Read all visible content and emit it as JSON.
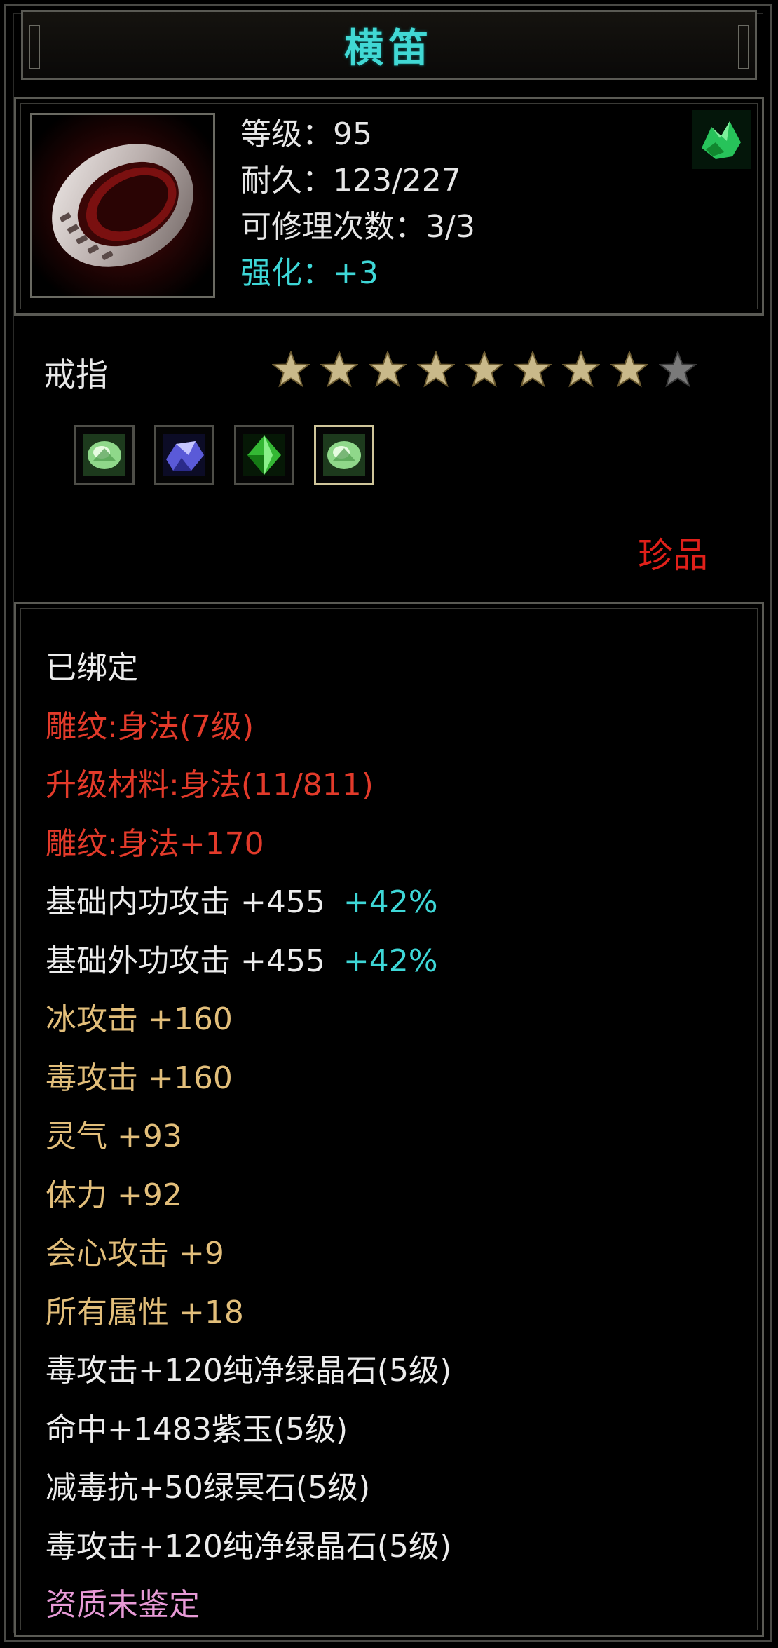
{
  "item": {
    "name": "横笛",
    "icon": "ring-icon",
    "badge_icon": "green-crystal-icon",
    "level_line": "等级：95",
    "durability_line": "耐久：123/227",
    "repairs_line": "可修理次数：3/3",
    "enhance_line": "强化：+3",
    "type": "戒指",
    "stars_filled": 8,
    "stars_total": 9,
    "gem_slots": [
      {
        "icon": "pale-green-gem-icon",
        "selected": false
      },
      {
        "icon": "purple-gem-icon",
        "selected": false
      },
      {
        "icon": "green-gem-icon",
        "selected": false
      },
      {
        "icon": "pale-green-gem-icon",
        "selected": true
      }
    ],
    "rarity": "珍品"
  },
  "attributes": [
    {
      "text": "已绑定",
      "color": "white"
    },
    {
      "text": "雕纹:身法(7级)",
      "color": "red"
    },
    {
      "text": "升级材料:身法(11/811)",
      "color": "red"
    },
    {
      "text": "雕纹:身法+170",
      "color": "red"
    },
    {
      "text": "基础内功攻击  +455",
      "color": "white",
      "bonus": "+42%"
    },
    {
      "text": "基础外功攻击  +455",
      "color": "white",
      "bonus": "+42%"
    },
    {
      "text": "冰攻击  +160",
      "color": "gold"
    },
    {
      "text": "毒攻击  +160",
      "color": "gold"
    },
    {
      "text": "灵气  +93",
      "color": "gold"
    },
    {
      "text": "体力  +92",
      "color": "gold"
    },
    {
      "text": "会心攻击  +9",
      "color": "gold"
    },
    {
      "text": "所有属性  +18",
      "color": "gold"
    },
    {
      "text": "毒攻击+120纯净绿晶石(5级)",
      "color": "white"
    },
    {
      "text": "命中+1483紫玉(5级)",
      "color": "white"
    },
    {
      "text": "减毒抗+50绿冥石(5级)",
      "color": "white"
    },
    {
      "text": "毒攻击+120纯净绿晶石(5级)",
      "color": "white"
    },
    {
      "text": "资质未鉴定",
      "color": "pink"
    }
  ],
  "colors": {
    "title": "#41d8d4",
    "rarity": "#e0201a",
    "star_filled": "#c9b98a",
    "star_empty": "#7a7a7a"
  }
}
